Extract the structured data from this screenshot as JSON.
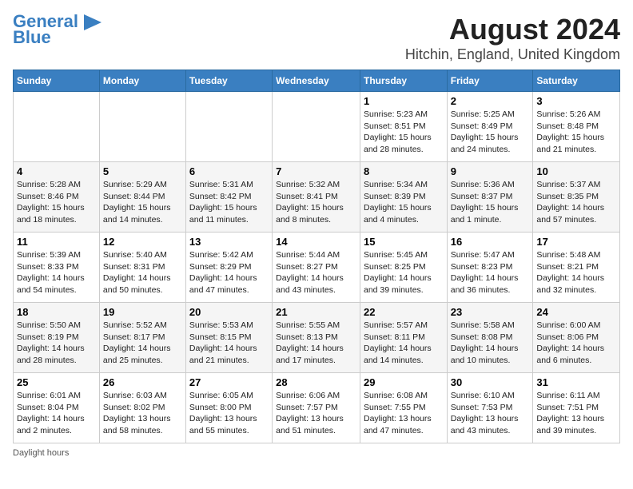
{
  "logo": {
    "text1": "General",
    "text2": "Blue"
  },
  "title": "August 2024",
  "subtitle": "Hitchin, England, United Kingdom",
  "days_of_week": [
    "Sunday",
    "Monday",
    "Tuesday",
    "Wednesday",
    "Thursday",
    "Friday",
    "Saturday"
  ],
  "footer": "Daylight hours",
  "weeks": [
    [
      {
        "day": "",
        "info": ""
      },
      {
        "day": "",
        "info": ""
      },
      {
        "day": "",
        "info": ""
      },
      {
        "day": "",
        "info": ""
      },
      {
        "day": "1",
        "info": "Sunrise: 5:23 AM\nSunset: 8:51 PM\nDaylight: 15 hours\nand 28 minutes."
      },
      {
        "day": "2",
        "info": "Sunrise: 5:25 AM\nSunset: 8:49 PM\nDaylight: 15 hours\nand 24 minutes."
      },
      {
        "day": "3",
        "info": "Sunrise: 5:26 AM\nSunset: 8:48 PM\nDaylight: 15 hours\nand 21 minutes."
      }
    ],
    [
      {
        "day": "4",
        "info": "Sunrise: 5:28 AM\nSunset: 8:46 PM\nDaylight: 15 hours\nand 18 minutes."
      },
      {
        "day": "5",
        "info": "Sunrise: 5:29 AM\nSunset: 8:44 PM\nDaylight: 15 hours\nand 14 minutes."
      },
      {
        "day": "6",
        "info": "Sunrise: 5:31 AM\nSunset: 8:42 PM\nDaylight: 15 hours\nand 11 minutes."
      },
      {
        "day": "7",
        "info": "Sunrise: 5:32 AM\nSunset: 8:41 PM\nDaylight: 15 hours\nand 8 minutes."
      },
      {
        "day": "8",
        "info": "Sunrise: 5:34 AM\nSunset: 8:39 PM\nDaylight: 15 hours\nand 4 minutes."
      },
      {
        "day": "9",
        "info": "Sunrise: 5:36 AM\nSunset: 8:37 PM\nDaylight: 15 hours\nand 1 minute."
      },
      {
        "day": "10",
        "info": "Sunrise: 5:37 AM\nSunset: 8:35 PM\nDaylight: 14 hours\nand 57 minutes."
      }
    ],
    [
      {
        "day": "11",
        "info": "Sunrise: 5:39 AM\nSunset: 8:33 PM\nDaylight: 14 hours\nand 54 minutes."
      },
      {
        "day": "12",
        "info": "Sunrise: 5:40 AM\nSunset: 8:31 PM\nDaylight: 14 hours\nand 50 minutes."
      },
      {
        "day": "13",
        "info": "Sunrise: 5:42 AM\nSunset: 8:29 PM\nDaylight: 14 hours\nand 47 minutes."
      },
      {
        "day": "14",
        "info": "Sunrise: 5:44 AM\nSunset: 8:27 PM\nDaylight: 14 hours\nand 43 minutes."
      },
      {
        "day": "15",
        "info": "Sunrise: 5:45 AM\nSunset: 8:25 PM\nDaylight: 14 hours\nand 39 minutes."
      },
      {
        "day": "16",
        "info": "Sunrise: 5:47 AM\nSunset: 8:23 PM\nDaylight: 14 hours\nand 36 minutes."
      },
      {
        "day": "17",
        "info": "Sunrise: 5:48 AM\nSunset: 8:21 PM\nDaylight: 14 hours\nand 32 minutes."
      }
    ],
    [
      {
        "day": "18",
        "info": "Sunrise: 5:50 AM\nSunset: 8:19 PM\nDaylight: 14 hours\nand 28 minutes."
      },
      {
        "day": "19",
        "info": "Sunrise: 5:52 AM\nSunset: 8:17 PM\nDaylight: 14 hours\nand 25 minutes."
      },
      {
        "day": "20",
        "info": "Sunrise: 5:53 AM\nSunset: 8:15 PM\nDaylight: 14 hours\nand 21 minutes."
      },
      {
        "day": "21",
        "info": "Sunrise: 5:55 AM\nSunset: 8:13 PM\nDaylight: 14 hours\nand 17 minutes."
      },
      {
        "day": "22",
        "info": "Sunrise: 5:57 AM\nSunset: 8:11 PM\nDaylight: 14 hours\nand 14 minutes."
      },
      {
        "day": "23",
        "info": "Sunrise: 5:58 AM\nSunset: 8:08 PM\nDaylight: 14 hours\nand 10 minutes."
      },
      {
        "day": "24",
        "info": "Sunrise: 6:00 AM\nSunset: 8:06 PM\nDaylight: 14 hours\nand 6 minutes."
      }
    ],
    [
      {
        "day": "25",
        "info": "Sunrise: 6:01 AM\nSunset: 8:04 PM\nDaylight: 14 hours\nand 2 minutes."
      },
      {
        "day": "26",
        "info": "Sunrise: 6:03 AM\nSunset: 8:02 PM\nDaylight: 13 hours\nand 58 minutes."
      },
      {
        "day": "27",
        "info": "Sunrise: 6:05 AM\nSunset: 8:00 PM\nDaylight: 13 hours\nand 55 minutes."
      },
      {
        "day": "28",
        "info": "Sunrise: 6:06 AM\nSunset: 7:57 PM\nDaylight: 13 hours\nand 51 minutes."
      },
      {
        "day": "29",
        "info": "Sunrise: 6:08 AM\nSunset: 7:55 PM\nDaylight: 13 hours\nand 47 minutes."
      },
      {
        "day": "30",
        "info": "Sunrise: 6:10 AM\nSunset: 7:53 PM\nDaylight: 13 hours\nand 43 minutes."
      },
      {
        "day": "31",
        "info": "Sunrise: 6:11 AM\nSunset: 7:51 PM\nDaylight: 13 hours\nand 39 minutes."
      }
    ]
  ]
}
